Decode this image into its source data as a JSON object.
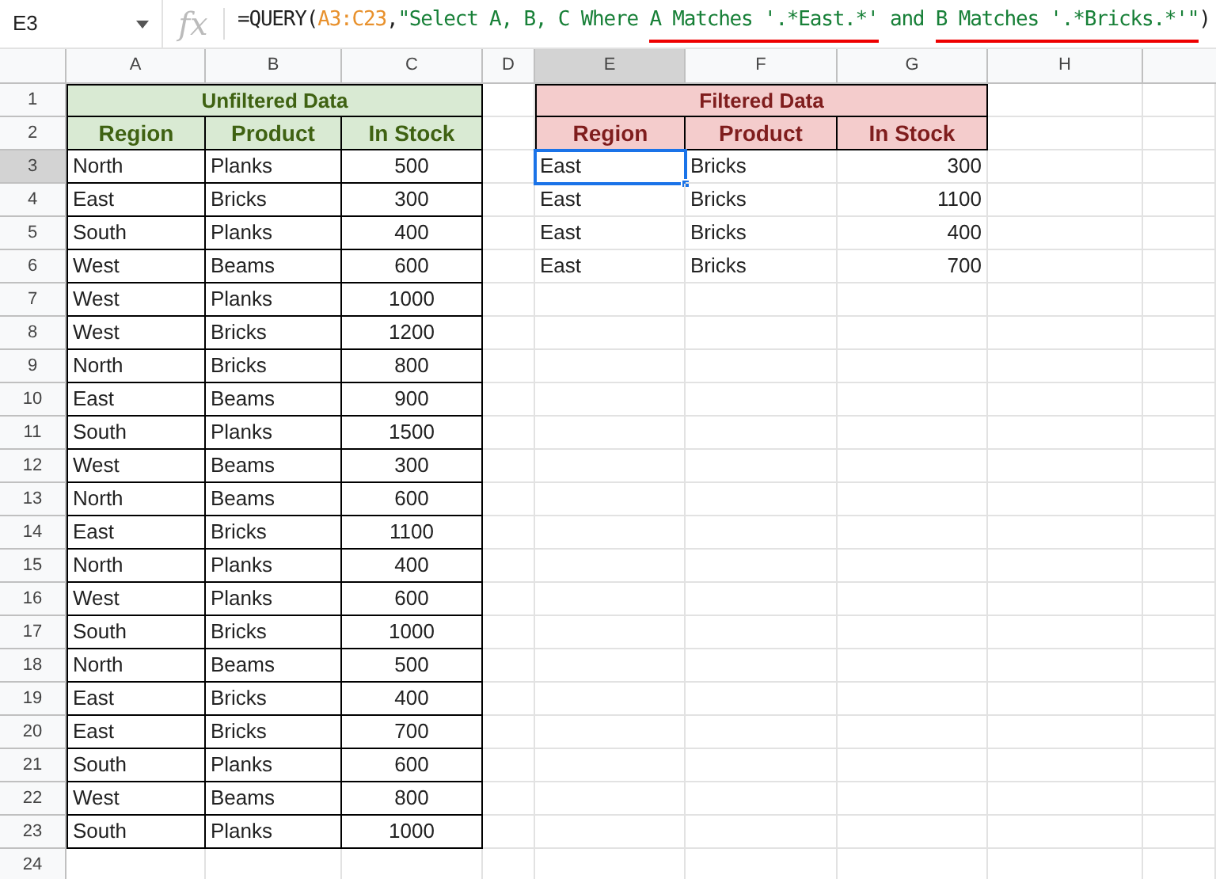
{
  "name_box": "E3",
  "fx_label": "fx",
  "formula": [
    {
      "kind": "plain",
      "text": "=QUERY(",
      "underlined": false
    },
    {
      "kind": "range",
      "text": "A3:C23",
      "separator": ",",
      "underlined": false
    },
    {
      "kind": "string",
      "text": "\"Select A, B, C Where ",
      "underlined": false
    },
    {
      "kind": "string",
      "text": "A Matches '.*East.*'",
      "underlined": true
    },
    {
      "kind": "string",
      "text": " and ",
      "underlined": false
    },
    {
      "kind": "string",
      "text": "B Matches '.*Bricks.*'\"",
      "underlined": true
    },
    {
      "kind": "plain",
      "text": ")",
      "underlined": false
    }
  ],
  "columns": [
    {
      "label": "A",
      "selected": false
    },
    {
      "label": "B",
      "selected": false
    },
    {
      "label": "C",
      "selected": false
    },
    {
      "label": "D",
      "selected": false
    },
    {
      "label": "E",
      "selected": true
    },
    {
      "label": "F",
      "selected": false
    },
    {
      "label": "G",
      "selected": false
    },
    {
      "label": "H",
      "selected": false
    }
  ],
  "row_numbers": [
    {
      "label": "1",
      "selected": false
    },
    {
      "label": "2",
      "selected": false
    },
    {
      "label": "3",
      "selected": true
    },
    {
      "label": "4",
      "selected": false
    },
    {
      "label": "5",
      "selected": false
    },
    {
      "label": "6",
      "selected": false
    },
    {
      "label": "7",
      "selected": false
    },
    {
      "label": "8",
      "selected": false
    },
    {
      "label": "9",
      "selected": false
    },
    {
      "label": "10",
      "selected": false
    },
    {
      "label": "11",
      "selected": false
    },
    {
      "label": "12",
      "selected": false
    },
    {
      "label": "13",
      "selected": false
    },
    {
      "label": "14",
      "selected": false
    },
    {
      "label": "15",
      "selected": false
    },
    {
      "label": "16",
      "selected": false
    },
    {
      "label": "17",
      "selected": false
    },
    {
      "label": "18",
      "selected": false
    },
    {
      "label": "19",
      "selected": false
    },
    {
      "label": "20",
      "selected": false
    },
    {
      "label": "21",
      "selected": false
    },
    {
      "label": "22",
      "selected": false
    },
    {
      "label": "23",
      "selected": false
    },
    {
      "label": "24",
      "selected": false
    }
  ],
  "tables": [
    {
      "kind": "source",
      "title": "Unfiltered Data",
      "headers": [
        "Region",
        "Product",
        "In Stock"
      ],
      "rows": [
        {
          "cells": [
            "North",
            "Planks",
            "500"
          ],
          "active": false
        },
        {
          "cells": [
            "East",
            "Bricks",
            "300"
          ],
          "active": false
        },
        {
          "cells": [
            "South",
            "Planks",
            "400"
          ],
          "active": false
        },
        {
          "cells": [
            "West",
            "Beams",
            "600"
          ],
          "active": false
        },
        {
          "cells": [
            "West",
            "Planks",
            "1000"
          ],
          "active": false
        },
        {
          "cells": [
            "West",
            "Bricks",
            "1200"
          ],
          "active": false
        },
        {
          "cells": [
            "North",
            "Bricks",
            "800"
          ],
          "active": false
        },
        {
          "cells": [
            "East",
            "Beams",
            "900"
          ],
          "active": false
        },
        {
          "cells": [
            "South",
            "Planks",
            "1500"
          ],
          "active": false
        },
        {
          "cells": [
            "West",
            "Beams",
            "300"
          ],
          "active": false
        },
        {
          "cells": [
            "North",
            "Beams",
            "600"
          ],
          "active": false
        },
        {
          "cells": [
            "East",
            "Bricks",
            "1100"
          ],
          "active": false
        },
        {
          "cells": [
            "North",
            "Planks",
            "400"
          ],
          "active": false
        },
        {
          "cells": [
            "West",
            "Planks",
            "600"
          ],
          "active": false
        },
        {
          "cells": [
            "South",
            "Bricks",
            "1000"
          ],
          "active": false
        },
        {
          "cells": [
            "North",
            "Beams",
            "500"
          ],
          "active": false
        },
        {
          "cells": [
            "East",
            "Bricks",
            "400"
          ],
          "active": false
        },
        {
          "cells": [
            "East",
            "Bricks",
            "700"
          ],
          "active": false
        },
        {
          "cells": [
            "South",
            "Planks",
            "600"
          ],
          "active": false
        },
        {
          "cells": [
            "West",
            "Beams",
            "800"
          ],
          "active": false
        },
        {
          "cells": [
            "South",
            "Planks",
            "1000"
          ],
          "active": false
        }
      ]
    },
    {
      "kind": "result",
      "title": "Filtered Data",
      "headers": [
        "Region",
        "Product",
        "In Stock"
      ],
      "rows": [
        {
          "cells": [
            "East",
            "Bricks",
            "300"
          ],
          "active": true
        },
        {
          "cells": [
            "East",
            "Bricks",
            "1100"
          ],
          "active": false
        },
        {
          "cells": [
            "East",
            "Bricks",
            "400"
          ],
          "active": false
        },
        {
          "cells": [
            "East",
            "Bricks",
            "700"
          ],
          "active": false
        }
      ]
    }
  ]
}
